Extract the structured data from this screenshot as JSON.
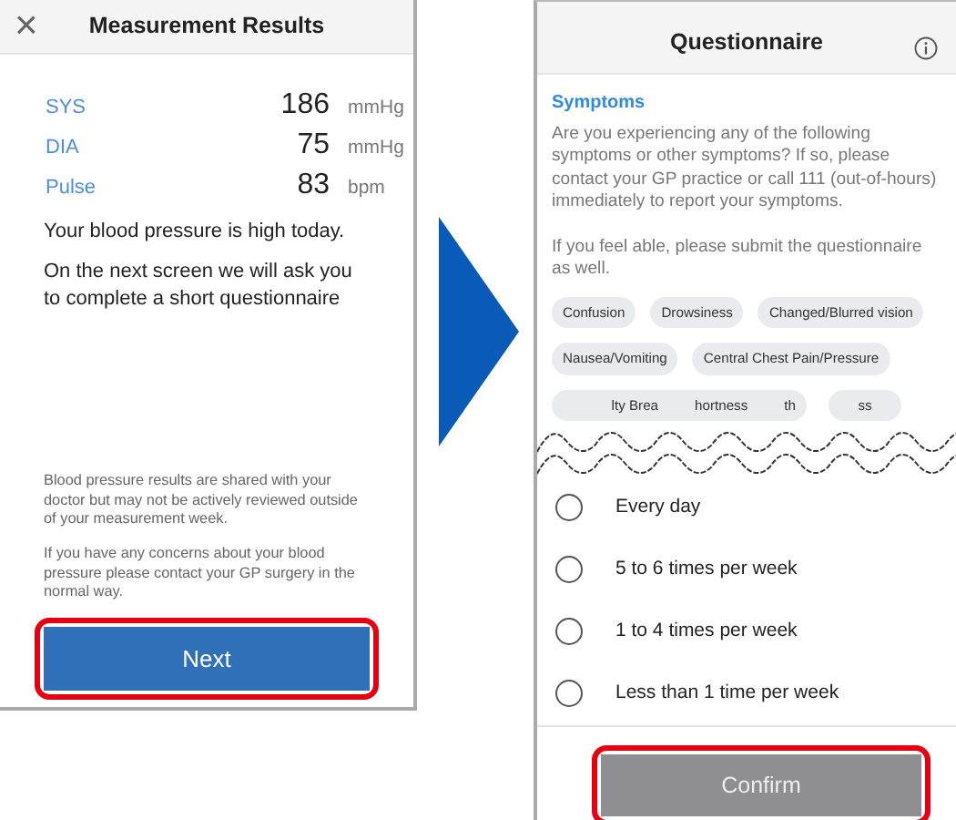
{
  "results_screen": {
    "title": "Measurement Results",
    "close_icon": "×",
    "readings": [
      {
        "label": "SYS",
        "value": "186",
        "unit": "mmHg"
      },
      {
        "label": "DIA",
        "value": "75",
        "unit": "mmHg"
      },
      {
        "label": "Pulse",
        "value": "83",
        "unit": "bpm"
      }
    ],
    "status": "Your blood pressure is high today.",
    "next_note": "On the next screen we will ask you to complete a short questionnaire",
    "notes": [
      "Blood pressure results are shared with your doctor but may not be actively reviewed outside of your measurement week.",
      "If you have any concerns about your blood pressure please contact your GP surgery in the normal way."
    ],
    "button": {
      "label": "Next",
      "highlighted": true
    }
  },
  "questionnaire_screen": {
    "title": "Questionnaire",
    "section": "Symptoms",
    "paragraphs": [
      "Are you experiencing any of the following symptoms or other symptoms? If so, please contact your GP practice or call 111 (out-of-hours) immediately to report your symptoms.",
      "If you feel able, please submit the questionnaire as well."
    ],
    "chip_rows": [
      [
        "Confusion",
        "Drowsiness",
        "Changed/Blurred vision"
      ],
      [
        "Nausea/Vomiting",
        "Central Chest Pain/Pressure"
      ]
    ],
    "torn_chips": [
      {
        "fragments": [
          "lty Brea",
          "hortness",
          "th"
        ]
      },
      {
        "fragments": [
          "ss"
        ]
      }
    ],
    "options": [
      {
        "label": "Every day",
        "selected": false
      },
      {
        "label": "5 to 6 times per week",
        "selected": false
      },
      {
        "label": "1 to 4 times per week",
        "selected": false
      },
      {
        "label": "Less than 1 time per week",
        "selected": false
      }
    ],
    "button": {
      "label": "Confirm",
      "disabled": true,
      "highlighted": true
    }
  }
}
